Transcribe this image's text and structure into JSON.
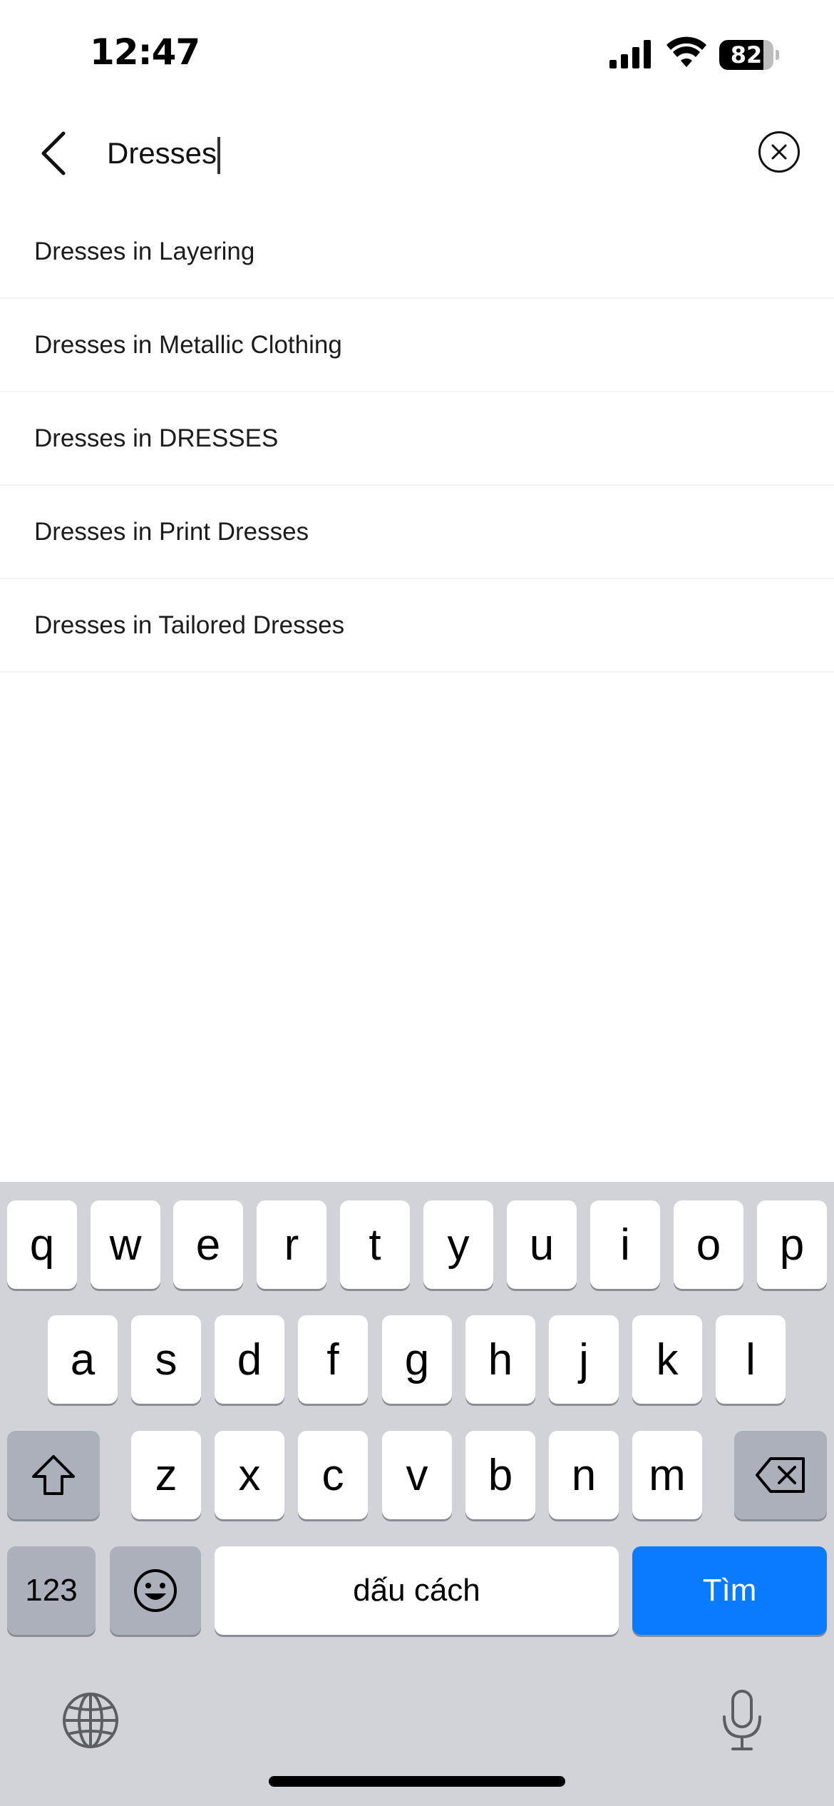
{
  "status_bar": {
    "time": "12:47",
    "battery_level": "82",
    "battery_fraction": 0.82
  },
  "search": {
    "value": "Dresses",
    "back_icon": "chevron-left-icon",
    "clear_icon": "circle-x-icon"
  },
  "suggestions": [
    "Dresses in Layering",
    "Dresses in Metallic Clothing",
    "Dresses in DRESSES",
    "Dresses in Print Dresses",
    "Dresses in Tailored Dresses"
  ],
  "keyboard": {
    "row1": [
      "q",
      "w",
      "e",
      "r",
      "t",
      "y",
      "u",
      "i",
      "o",
      "p"
    ],
    "row2": [
      "a",
      "s",
      "d",
      "f",
      "g",
      "h",
      "j",
      "k",
      "l"
    ],
    "row3": [
      "z",
      "x",
      "c",
      "v",
      "b",
      "n",
      "m"
    ],
    "numbers_label": "123",
    "space_label": "dấu cách",
    "search_label": "Tìm",
    "accent_color": "#0a7bff"
  }
}
